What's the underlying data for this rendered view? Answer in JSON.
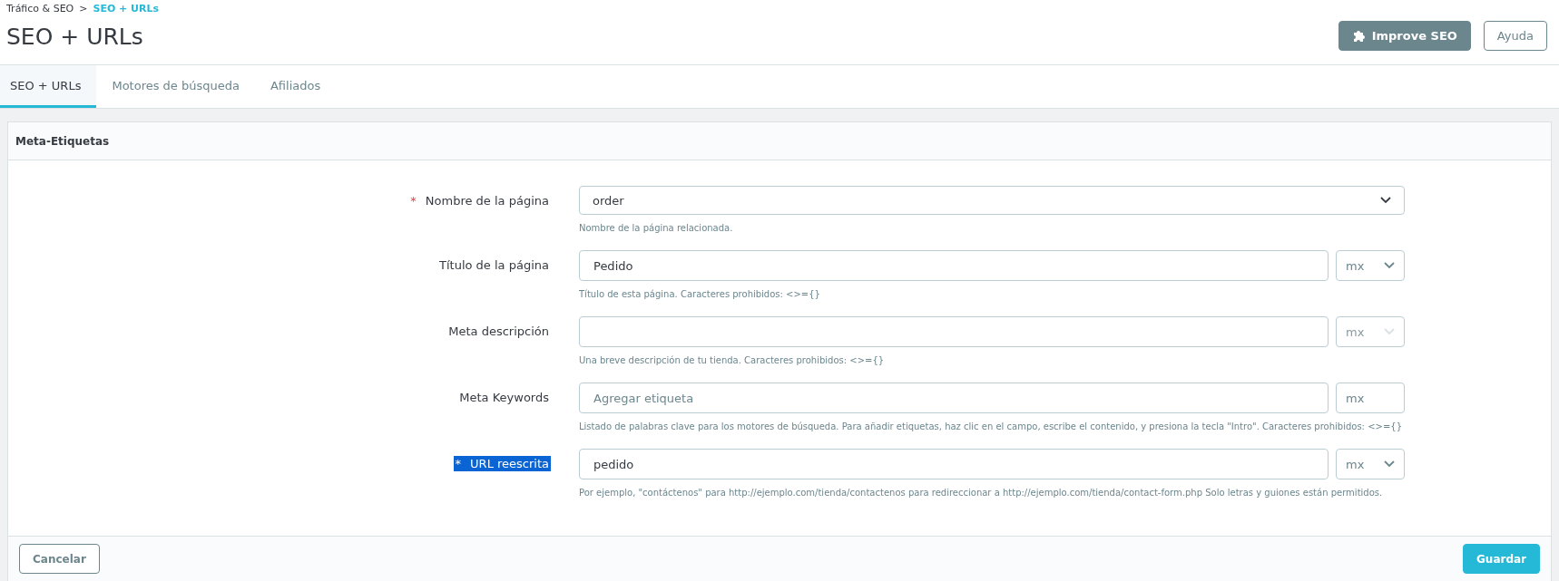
{
  "breadcrumb": [
    {
      "label": "Tráfico & SEO",
      "current": false
    },
    {
      "label": "SEO + URLs",
      "current": true
    }
  ],
  "breadcrumb_separator": ">",
  "page_title": "SEO + URLs",
  "header_buttons": [
    {
      "label": "Improve SEO",
      "kind": "primary"
    },
    {
      "label": "Ayuda",
      "kind": "outline"
    }
  ],
  "tabs": [
    {
      "label": "SEO + URLs",
      "selected": true
    },
    {
      "label": "Motores de búsqueda",
      "selected": false
    },
    {
      "label": "Afiliados",
      "selected": false
    }
  ],
  "panel": {
    "title": "Meta-Etiquetas",
    "fields": [
      {
        "label": "Nombre de la página",
        "required": true,
        "highlighted": false,
        "kind": "select",
        "value": "order",
        "help": "Nombre de la página relacionada."
      },
      {
        "label": "Título de la página",
        "required": false,
        "highlighted": false,
        "kind": "text",
        "value": "Pedido",
        "help": "Título de esta página. Caracteres prohibidos: <>={}",
        "lang": {
          "label": "mx",
          "kind": "select",
          "disabled": false
        }
      },
      {
        "label": "Meta descripción",
        "required": false,
        "highlighted": false,
        "kind": "text",
        "help": "Una breve descripción de tu tienda. Caracteres prohibidos: <>={}",
        "lang": {
          "label": "mx",
          "kind": "select",
          "disabled": true
        }
      },
      {
        "label": "Meta Keywords",
        "required": false,
        "highlighted": false,
        "kind": "text",
        "placeholder": "Agregar etiqueta",
        "help": "Listado de palabras clave para los motores de búsqueda. Para añadir etiquetas, haz clic en el campo, escribe el contenido, y presiona la tecla \"Intro\". Caracteres prohibidos: <>={}",
        "lang": {
          "label": "mx",
          "kind": "plain",
          "disabled": false
        }
      },
      {
        "label": "URL reescrita",
        "required": true,
        "highlighted": true,
        "kind": "text",
        "value": "pedido",
        "help": "Por ejemplo, \"contáctenos\" para http://ejemplo.com/tienda/contactenos para redireccionar a http://ejemplo.com/tienda/contact-form.php Solo letras y guiones están permitidos.",
        "lang": {
          "label": "mx",
          "kind": "select",
          "disabled": false
        }
      }
    ],
    "required_mark": "*",
    "footer_buttons": [
      {
        "label": "Cancelar",
        "kind": "outline"
      },
      {
        "label": "Guardar",
        "kind": "primary"
      }
    ]
  }
}
